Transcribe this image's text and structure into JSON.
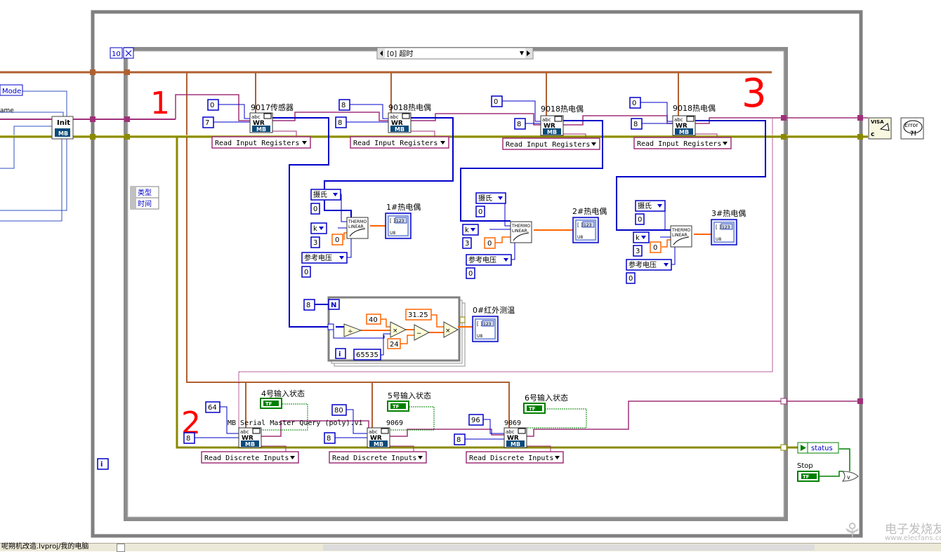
{
  "case_structure": {
    "loop_count": "10",
    "selector_label": "[0] 超时"
  },
  "annotations": [
    "1",
    "2",
    "3"
  ],
  "left_panel": {
    "mode_label": "Mode",
    "name_label": "ame",
    "init_label": "Init",
    "mb_badge": "MB"
  },
  "cluster_labels": [
    "类型",
    "时间"
  ],
  "modbus_blocks": [
    {
      "title": "9017传感器",
      "const_a": "0",
      "const_b": "7",
      "mode": "Read Input Registers"
    },
    {
      "title": "9018热电偶",
      "const_a": "8",
      "const_b": "8",
      "mode": "Read Input Registers"
    },
    {
      "title": "9018热电偶",
      "const_a": "0",
      "const_b": "8",
      "mode": "Read Input Registers"
    },
    {
      "title": "9018热电偶",
      "const_a": "0",
      "const_b": "8",
      "mode": "Read Input Registers"
    }
  ],
  "thermocouples": [
    {
      "unit": "摄氏",
      "unit_val": "0",
      "type": "k",
      "type_val": "3",
      "ref": "参考电压",
      "ref_val": "0",
      "cj": "0",
      "indicator": "1#热电偶",
      "fn": "THERMO LINEAR"
    },
    {
      "unit": "摄氏",
      "unit_val": "0",
      "type": "k",
      "type_val": "3",
      "ref": "参考电压",
      "ref_val": "0",
      "cj": "0",
      "indicator": "2#热电偶",
      "fn": "THERMO LINEAR"
    },
    {
      "unit": "摄氏",
      "unit_val": "0",
      "type": "k",
      "type_val": "3",
      "ref": "参考电压",
      "ref_val": "0",
      "cj": "0",
      "indicator": "3#热电偶",
      "fn": "THERMO LINEAR"
    }
  ],
  "for_loop": {
    "n_const": "8",
    "n_label": "N",
    "i_label": "i",
    "c40": "40",
    "c24": "24",
    "c3125": "31.25",
    "c65535": "65535",
    "indicator": "0#红外测温"
  },
  "discrete_blocks": [
    {
      "label": "4号输入状态",
      "const_a": "64",
      "const_b": "8",
      "title": "MB Serial Master Query (poly).vi",
      "mode": "Read Discrete Inputs"
    },
    {
      "label": "5号输入状态",
      "const_a": "80",
      "const_b": "8",
      "title": "9069",
      "mode": "Read Discrete Inputs"
    },
    {
      "label": "6号输入状态",
      "const_a": "96",
      "const_b": "8",
      "title": "9069",
      "mode": "Read Discrete Inputs"
    }
  ],
  "tf_label": "TF",
  "outer_i": "i",
  "right_panel": {
    "visa_label": "VISA",
    "error_label": "Error",
    "status_label": "status",
    "stop_label": "Stop"
  },
  "statusbar": {
    "path_text": "呢朔机改造.lvproj/我的电脑"
  },
  "watermark": {
    "brand": "电子发烧友",
    "url": "www.elecfans.com"
  },
  "colors": {
    "orange_wire": "#ff6600",
    "blue_wire": "#0000c8",
    "brown_wire": "#b06030",
    "pink_wire": "#a0307a",
    "olive_wire": "#8a8a00",
    "green_wire": "#008000",
    "red_annot": "#ff0000",
    "frame_gray": "#808080"
  }
}
